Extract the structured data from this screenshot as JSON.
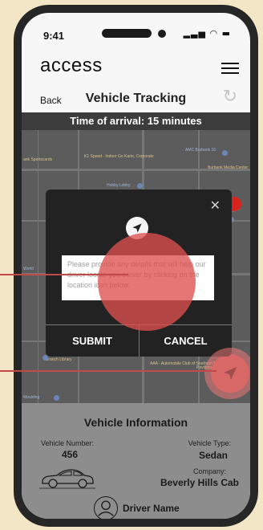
{
  "status_bar": {
    "time": "9:41"
  },
  "header": {
    "brand": "access",
    "back_label": "Back",
    "title": "Vehicle Tracking"
  },
  "arrival_banner": "Time of arrival: 15 minutes",
  "map": {
    "places": [
      "ank Sportscards",
      "K1 Speed - Indoor Go Karts, Corporate",
      "AMC Burbank 16",
      "Hobby Lobby",
      "Burbank Media Center",
      "World",
      "AAA - Automobile Club of Southern California",
      "Branch Library",
      "Pavilions",
      "Moulding"
    ]
  },
  "modal": {
    "placeholder": "Please provide any details that will help our driver locate you easier by clicking on the location icon below.",
    "submit_label": "SUBMIT",
    "cancel_label": "CANCEL"
  },
  "vehicle_info": {
    "title": "Vehicle Information",
    "number_label": "Vehicle Number:",
    "number_value": "456",
    "type_label": "Vehicle Type:",
    "type_value": "Sedan",
    "company_label": "Company:",
    "company_value": "Beverly Hills Cab",
    "driver_name": "Driver Name"
  },
  "colors": {
    "background": "#f2e6c6",
    "phone_frame": "#262626",
    "modal": "#222222",
    "accent_red": "#c25453",
    "highlight": "#dd5050"
  },
  "icons": [
    "signal-icon",
    "wifi-icon",
    "battery-icon",
    "hamburger-menu-icon",
    "refresh-icon",
    "close-icon",
    "location-arrow-icon",
    "car-icon",
    "user-icon"
  ]
}
